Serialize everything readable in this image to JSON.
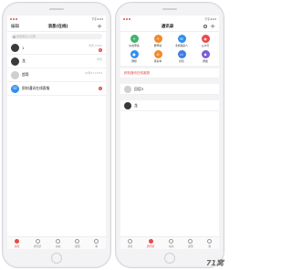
{
  "status": {
    "time": "下午4:03"
  },
  "messages": {
    "header": {
      "title": "消息(在线)",
      "left": "编辑",
      "plus": "+"
    },
    "search_placeholder": "搜索联系人记录",
    "items": [
      {
        "name": "1",
        "sub": "",
        "time": "昨天 15:02",
        "badge": "1"
      },
      {
        "name": "龙",
        "sub": "",
        "time": "昨天",
        "badge": ""
      },
      {
        "name": "超哥",
        "sub": "",
        "time": "09月01 15:03",
        "badge": ""
      },
      {
        "name": "即刻通讯在线客服",
        "sub": "",
        "time": "",
        "badge": "1"
      }
    ],
    "tabs": [
      {
        "label": "消息",
        "active": true
      },
      {
        "label": "通讯录",
        "active": false
      },
      {
        "label": "动态",
        "active": false
      },
      {
        "label": "发现",
        "active": false
      },
      {
        "label": "我",
        "active": false
      }
    ]
  },
  "contacts": {
    "header": {
      "title": "通讯录",
      "plus": "+"
    },
    "grid": [
      {
        "label": "好友申请",
        "color": "#3fb36b"
      },
      {
        "label": "群申请",
        "color": "#f08a2c"
      },
      {
        "label": "手机联系人",
        "color": "#2f8ff0"
      },
      {
        "label": "公众号",
        "color": "#e84a4a"
      },
      {
        "label": "群组",
        "color": "#2f8ff0"
      },
      {
        "label": "黑名单",
        "color": "#f08a2c"
      },
      {
        "label": "标签",
        "color": "#3d7ee0"
      },
      {
        "label": "群发",
        "color": "#7d5bd6"
      }
    ],
    "service_row": "即刻通讯在线客服",
    "list": [
      {
        "name": "回话3"
      },
      {
        "name": "龙"
      }
    ],
    "tabs": [
      {
        "label": "消息",
        "active": false
      },
      {
        "label": "通讯录",
        "active": true
      },
      {
        "label": "动态",
        "active": false
      },
      {
        "label": "发现",
        "active": false
      },
      {
        "label": "我",
        "active": false
      }
    ]
  },
  "watermark": "71窝"
}
